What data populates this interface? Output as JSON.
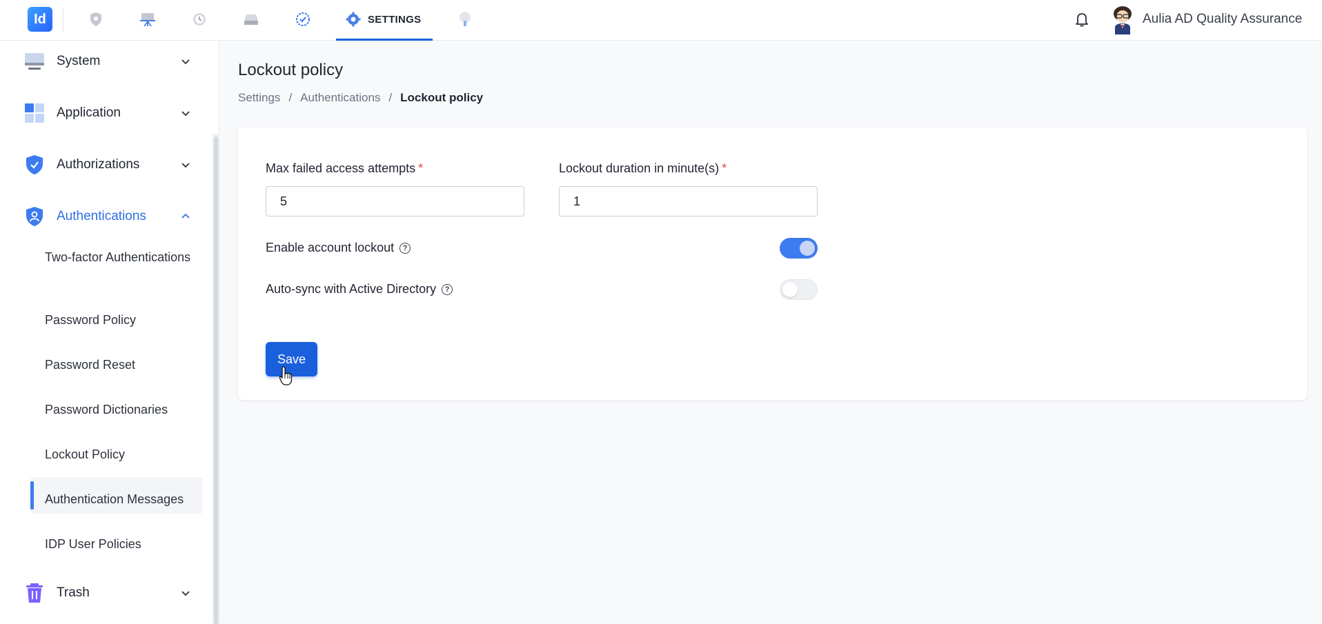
{
  "header": {
    "logo_text": "Id",
    "settings_tab_label": "SETTINGS",
    "user_name": "Aulia AD Quality Assurance",
    "accent_color": "#1a62e0"
  },
  "sidebar": {
    "groups": [
      {
        "label": "System",
        "icon": "monitor-icon"
      },
      {
        "label": "Application",
        "icon": "grid-icon"
      },
      {
        "label": "Authorizations",
        "icon": "shield-check-icon"
      },
      {
        "label": "Authentications",
        "icon": "shield-user-icon"
      },
      {
        "label": "Trash",
        "icon": "trash-icon"
      }
    ],
    "sub_items": [
      {
        "label": "Two-factor Authentications"
      },
      {
        "label": "Password Policy"
      },
      {
        "label": "Password Reset"
      },
      {
        "label": "Password Dictionaries"
      },
      {
        "label": "Lockout Policy"
      },
      {
        "label": "Authentication Messages"
      },
      {
        "label": "IDP User Policies"
      }
    ]
  },
  "page": {
    "title": "Lockout policy",
    "breadcrumb": [
      "Settings",
      "Authentications",
      "Lockout policy"
    ],
    "breadcrumb_sep": "/"
  },
  "form": {
    "max_attempts_label": "Max failed access attempts",
    "max_attempts_value": "5",
    "duration_label": "Lockout duration in minute(s)",
    "duration_value": "1",
    "required_mark": "*",
    "enable_lockout_label": "Enable account lockout",
    "enable_lockout_on": true,
    "autosync_label": "Auto-sync with Active Directory",
    "autosync_on": false,
    "help_glyph": "?",
    "save_label": "Save"
  }
}
